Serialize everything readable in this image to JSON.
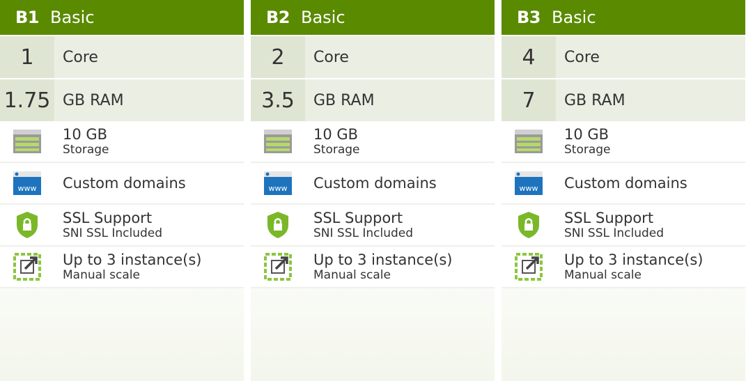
{
  "plans": [
    {
      "tier": "B1",
      "name": "Basic",
      "cores": "1",
      "core_label": "Core",
      "ram": "1.75",
      "ram_label": "GB RAM",
      "storage": "10 GB",
      "storage_label": "Storage",
      "domains": "Custom domains",
      "ssl": "SSL Support",
      "ssl_sub": "SNI SSL Included",
      "scale": "Up to 3 instance(s)",
      "scale_sub": "Manual scale"
    },
    {
      "tier": "B2",
      "name": "Basic",
      "cores": "2",
      "core_label": "Core",
      "ram": "3.5",
      "ram_label": "GB RAM",
      "storage": "10 GB",
      "storage_label": "Storage",
      "domains": "Custom domains",
      "ssl": "SSL Support",
      "ssl_sub": "SNI SSL Included",
      "scale": "Up to 3 instance(s)",
      "scale_sub": "Manual scale"
    },
    {
      "tier": "B3",
      "name": "Basic",
      "cores": "4",
      "core_label": "Core",
      "ram": "7",
      "ram_label": "GB RAM",
      "storage": "10 GB",
      "storage_label": "Storage",
      "domains": "Custom domains",
      "ssl": "SSL Support",
      "ssl_sub": "SNI SSL Included",
      "scale": "Up to 3 instance(s)",
      "scale_sub": "Manual scale"
    }
  ],
  "colors": {
    "header": "#5a8a00",
    "accent": "#8cc63f",
    "www": "#1e73be"
  },
  "icons": {
    "storage": "storage-icon",
    "domain": "www-icon",
    "ssl": "ssl-shield-icon",
    "scale": "scale-icon"
  }
}
